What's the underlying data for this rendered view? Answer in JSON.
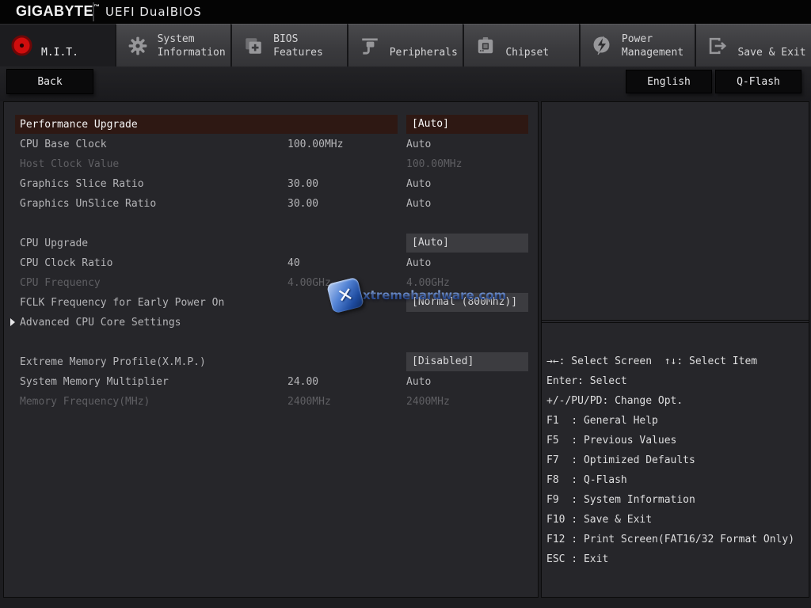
{
  "header": {
    "brand": "GIGABYTE",
    "trademark": "™",
    "product": "UEFI DualBIOS"
  },
  "tabs": [
    {
      "id": "mit",
      "label": "M.I.T.",
      "icon": "red-dot",
      "active": true
    },
    {
      "id": "system-information",
      "label": "System\nInformation",
      "icon": "gear",
      "active": false
    },
    {
      "id": "bios-features",
      "label": "BIOS\nFeatures",
      "icon": "folder-plus",
      "active": false
    },
    {
      "id": "peripherals",
      "label": "Peripherals",
      "icon": "plug",
      "active": false
    },
    {
      "id": "chipset",
      "label": "Chipset",
      "icon": "chip",
      "active": false
    },
    {
      "id": "power-management",
      "label": "Power\nManagement",
      "icon": "lightning",
      "active": false
    },
    {
      "id": "save-exit",
      "label": "Save & Exit",
      "icon": "exit",
      "active": false
    }
  ],
  "toolbar": {
    "back_label": "Back",
    "language_label": "English",
    "qflash_label": "Q-Flash"
  },
  "settings": {
    "rows": [
      {
        "label": "Performance Upgrade",
        "current": "",
        "value": "[Auto]",
        "boxed": true,
        "selected": true
      },
      {
        "label": "CPU Base Clock",
        "current": "100.00MHz",
        "value": "Auto"
      },
      {
        "label": "Host Clock Value",
        "current": "",
        "value": "100.00MHz",
        "disabled": true
      },
      {
        "label": "Graphics Slice Ratio",
        "current": "30.00",
        "value": "Auto"
      },
      {
        "label": "Graphics UnSlice Ratio",
        "current": "30.00",
        "value": "Auto"
      },
      {
        "spacer": true
      },
      {
        "label": "CPU Upgrade",
        "current": "",
        "value": "[Auto]",
        "boxed": true
      },
      {
        "label": "CPU Clock Ratio",
        "current": "40",
        "value": "Auto"
      },
      {
        "label": "CPU Frequency",
        "current": "4.00GHz",
        "value": "4.00GHz",
        "disabled": true
      },
      {
        "label": "FCLK Frequency for Early Power On",
        "current": "",
        "value": "[Normal (800Mhz)]",
        "boxed": true
      },
      {
        "label": "Advanced CPU Core Settings",
        "current": "",
        "value": "",
        "submenu": true
      },
      {
        "spacer": true
      },
      {
        "label": "Extreme Memory Profile(X.M.P.)",
        "current": "",
        "value": "[Disabled]",
        "boxed": true
      },
      {
        "label": "System Memory Multiplier",
        "current": "24.00",
        "value": "Auto"
      },
      {
        "label": "Memory Frequency(MHz)",
        "current": "2400MHz",
        "value": "2400MHz",
        "disabled": true
      }
    ]
  },
  "help": {
    "lines": [
      "→←: Select Screen  ↑↓: Select Item",
      "Enter: Select",
      "+/-/PU/PD: Change Opt.",
      "F1  : General Help",
      "F5  : Previous Values",
      "F7  : Optimized Defaults",
      "F8  : Q-Flash",
      "F9  : System Information",
      "F10 : Save & Exit",
      "F12 : Print Screen(FAT16/32 Format Only)",
      "ESC : Exit"
    ]
  },
  "watermark": {
    "text": "xtremehardware.com"
  },
  "colors": {
    "accent_red": "#dd0c0c",
    "selected_row_bg": "#2e1813",
    "value_cell_bg": "#3c3c40",
    "watermark_blue": "#3f6fca"
  }
}
